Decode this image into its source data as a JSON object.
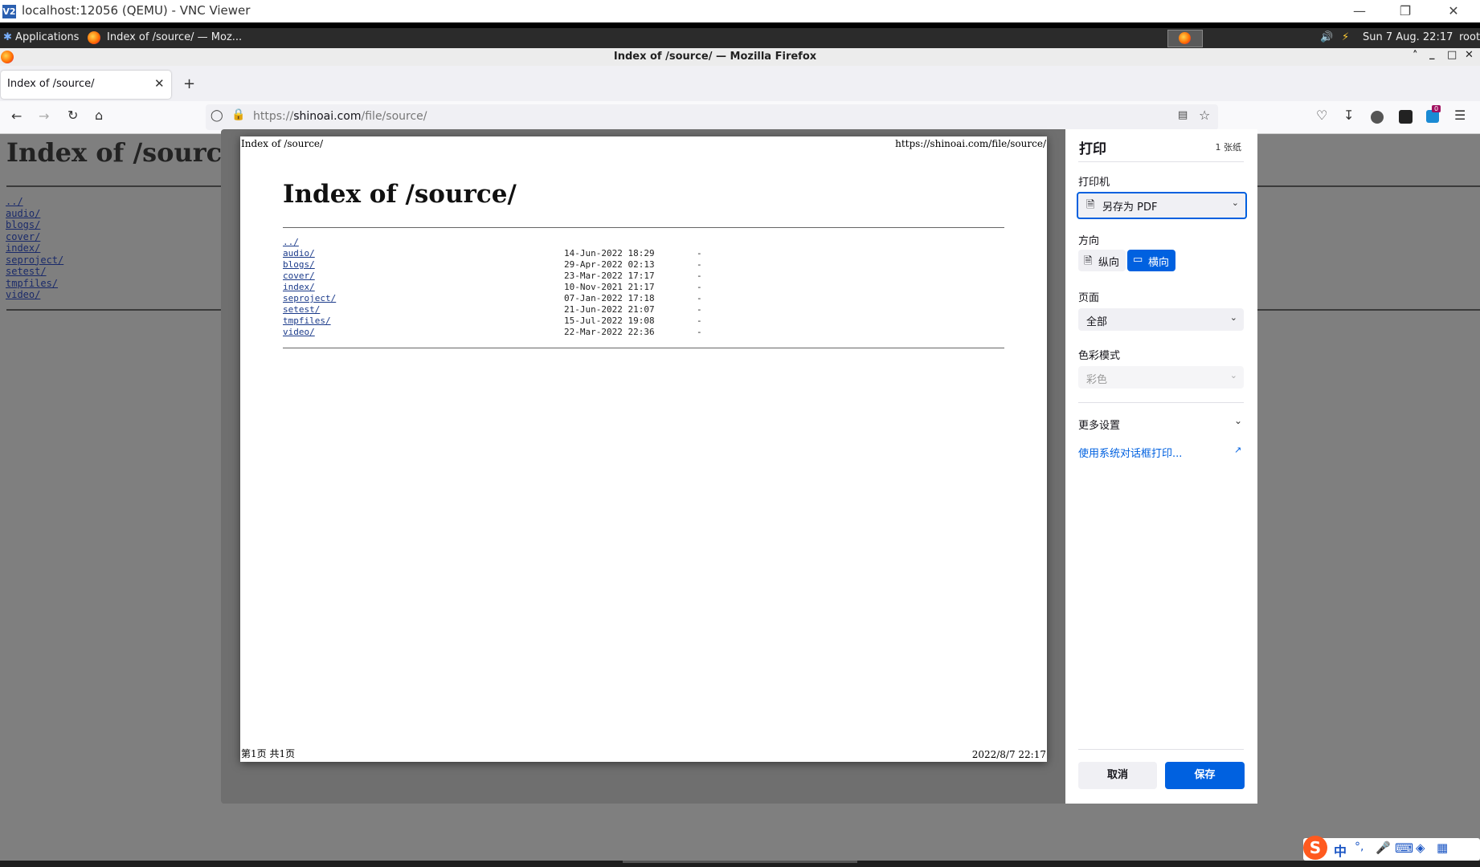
{
  "vnc": {
    "title": "localhost:12056 (QEMU) - VNC Viewer",
    "logo": "V2"
  },
  "panel": {
    "applications": "Applications",
    "task": "Index of /source/ — Moz...",
    "clock": "Sun  7 Aug. 22:17",
    "user": "root"
  },
  "firefox": {
    "window_title": "Index of /source/ — Mozilla Firefox",
    "tab_title": "Index of /source/",
    "url_scheme": "https://",
    "url_host": "shinoai.com",
    "url_path": "/file/source/",
    "badge_count": "0"
  },
  "page": {
    "heading": "Index of /source",
    "entries": [
      "../",
      "audio/",
      "blogs/",
      "cover/",
      "index/",
      "seproject/",
      "setest/",
      "tmpfiles/",
      "video/"
    ]
  },
  "preview": {
    "header_left": "Index of /source/",
    "header_right": "https://shinoai.com/file/source/",
    "footer_left": "第1页 共1页",
    "footer_right": "2022/8/7 22:17",
    "heading": "Index of /source/",
    "parent": "../",
    "rows": [
      {
        "name": "audio/",
        "date": "14-Jun-2022 18:29",
        "size": "-"
      },
      {
        "name": "blogs/",
        "date": "29-Apr-2022 02:13",
        "size": "-"
      },
      {
        "name": "cover/",
        "date": "23-Mar-2022 17:17",
        "size": "-"
      },
      {
        "name": "index/",
        "date": "10-Nov-2021 21:17",
        "size": "-"
      },
      {
        "name": "seproject/",
        "date": "07-Jan-2022 17:18",
        "size": "-"
      },
      {
        "name": "setest/",
        "date": "21-Jun-2022 21:07",
        "size": "-"
      },
      {
        "name": "tmpfiles/",
        "date": "15-Jul-2022 19:08",
        "size": "-"
      },
      {
        "name": "video/",
        "date": "22-Mar-2022 22:36",
        "size": "-"
      }
    ]
  },
  "print": {
    "title": "打印",
    "sheets": "1 张纸",
    "printer_label": "打印机",
    "printer_value": "另存为 PDF",
    "orientation_label": "方向",
    "portrait": "纵向",
    "landscape": "横向",
    "pages_label": "页面",
    "pages_value": "全部",
    "color_label": "色彩模式",
    "color_value": "彩色",
    "more_settings": "更多设置",
    "system_dialog": "使用系统对话框打印...",
    "cancel": "取消",
    "save": "保存",
    "accent": "#0061e0"
  },
  "ime": {
    "mode": "中"
  }
}
